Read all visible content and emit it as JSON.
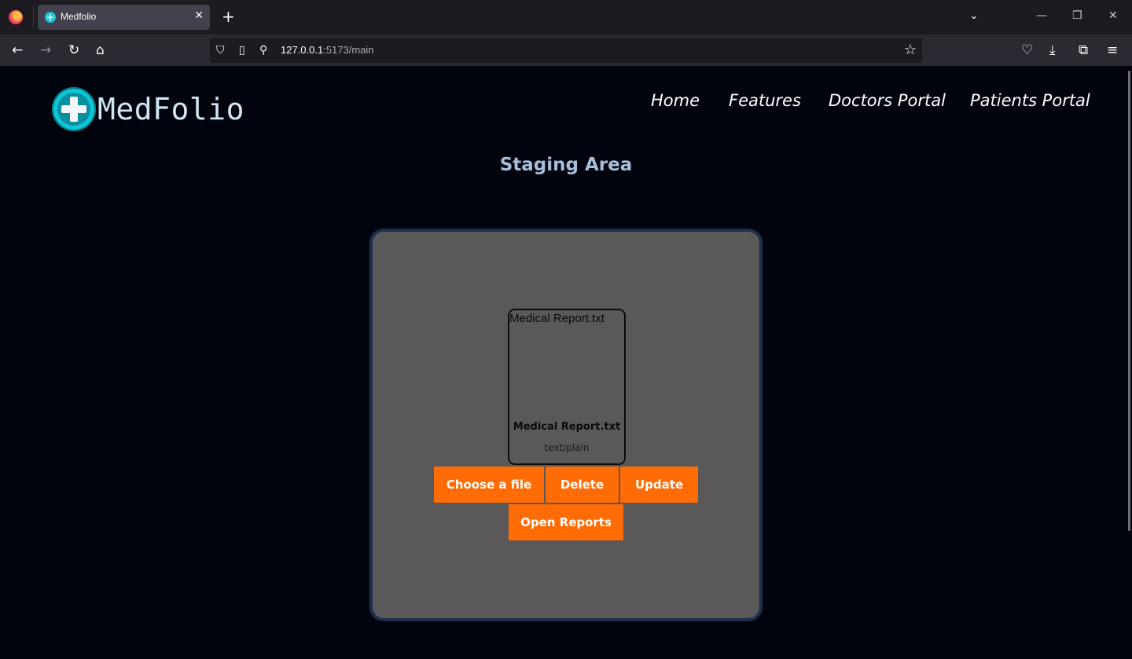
{
  "browser": {
    "tab_title": "Medfolio",
    "tab_favicon": "plus-icon",
    "url_host": "127.0.0.1",
    "url_rest": ":5173/main",
    "icons": [
      "back-icon",
      "forward-icon",
      "reload-icon",
      "home-icon",
      "shield-icon",
      "page-icon",
      "permissions-icon",
      "star-icon",
      "pocket-icon",
      "download-icon",
      "extensions-icon",
      "menu-icon"
    ]
  },
  "header": {
    "brand": "MedFolio",
    "nav": [
      {
        "label": "Home"
      },
      {
        "label": "Features"
      },
      {
        "label": "Doctors Portal"
      },
      {
        "label": "Patients Portal"
      }
    ]
  },
  "main": {
    "title": "Staging Area",
    "file": {
      "preview_text": "Medical Report.txt",
      "name": "Medical Report.txt",
      "type": "text/plain"
    },
    "buttons": {
      "choose": "Choose a file",
      "delete": "Delete",
      "update": "Update",
      "open_reports": "Open Reports"
    }
  },
  "colors": {
    "page_bg": "#02040d",
    "accent": "#ff6c05",
    "panel_bg": "#5a5858",
    "panel_border": "#1e2e4b",
    "brand_teal": "#0fc6d6",
    "heading": "#a6bfd7"
  }
}
